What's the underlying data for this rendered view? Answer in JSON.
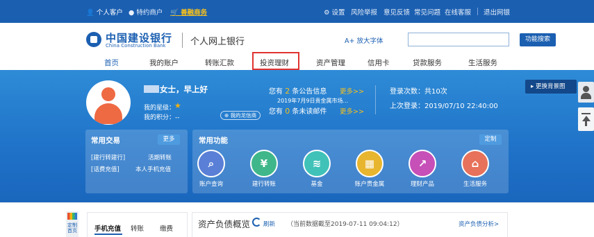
{
  "topbar": {
    "personal": "个人客户",
    "vip": "特约商户",
    "finance": "善融商务",
    "settings": "设置",
    "risk": "风险举报",
    "feedback": "意见反馈",
    "faq": "常见问题",
    "online_service": "在线客服",
    "logout": "退出网银"
  },
  "header": {
    "bank_name_cn": "中国建设银行",
    "bank_name_en": "China Construction Bank",
    "site_title": "个人网上银行",
    "font_size_label": "放大字体",
    "search_placeholder": "",
    "search_button": "功能搜索"
  },
  "nav": {
    "items": [
      "首页",
      "我的账户",
      "转账汇款",
      "投资理财",
      "资产管理",
      "信用卡",
      "贷款服务",
      "生活服务"
    ]
  },
  "profile": {
    "greeting": "女士，早上好",
    "star_label": "我的星级：",
    "points_label": "我的积分：--",
    "dragon_card": "我的龙信商"
  },
  "notices": {
    "line1_prefix": "您有",
    "line1_count": "2",
    "line1_suffix": "条公告信息",
    "line1_more": "更多>>",
    "line2": "2019年7月9日贵金属市场...",
    "line3_prefix": "您有",
    "line3_count": "0",
    "line3_suffix": "条未读邮件",
    "line3_more": "更多>>"
  },
  "login_info": {
    "count": "登录次数：共10次",
    "last": "上次登录：2019/07/10 22:40:00"
  },
  "background_button": "更换背景图",
  "common_trans": {
    "title": "常用交易",
    "more": "更多",
    "links": [
      "[建行转建行]",
      "活期转账",
      "[话费充值]",
      "本人手机充值"
    ]
  },
  "common_funcs": {
    "title": "常用功能",
    "customize": "定制",
    "items": [
      {
        "label": "账户查询",
        "icon": "account-query-icon",
        "color": "#5a7fd6"
      },
      {
        "label": "建行转账",
        "icon": "transfer-icon",
        "color": "#3fb78a"
      },
      {
        "label": "基金",
        "icon": "fund-icon",
        "color": "#40c2b8"
      },
      {
        "label": "账户贵金属",
        "icon": "gold-icon",
        "color": "#e8b52e"
      },
      {
        "label": "理财产品",
        "icon": "wealth-icon",
        "color": "#c64fb8"
      },
      {
        "label": "生活服务",
        "icon": "life-icon",
        "color": "#e7715a"
      }
    ]
  },
  "bottom": {
    "custom_home": "定制首页",
    "tabs": [
      "手机充值",
      "转账",
      "缴费"
    ],
    "asset_title": "资产负债概览",
    "refresh": "刷新",
    "asset_date": "（当前数据截至2019-07-11 09:04:12）",
    "asset_analysis": "资产负债分析>"
  },
  "colors": {
    "brand": "#1b5fb1",
    "highlight": "#e0322f",
    "accent": "#f6c11d"
  }
}
